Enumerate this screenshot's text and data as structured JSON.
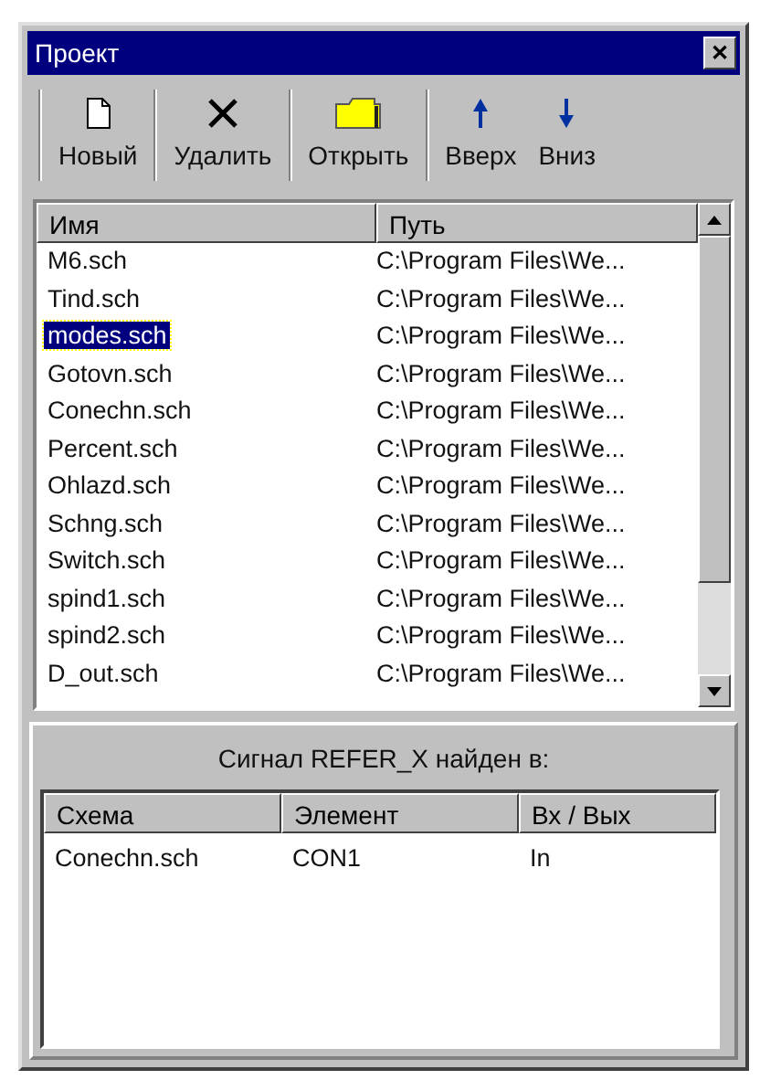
{
  "window": {
    "title": "Проект",
    "close": "✕"
  },
  "toolbar": [
    {
      "kind": "new",
      "label": "Новый"
    },
    {
      "kind": "delete",
      "label": "Удалить"
    },
    {
      "kind": "open",
      "label": "Открыть"
    },
    {
      "kind": "up",
      "label": "Вверх"
    },
    {
      "kind": "down",
      "label": "Вниз"
    }
  ],
  "files": {
    "columns": [
      "Имя",
      "Путь"
    ],
    "rows": [
      {
        "name": "M6.sch",
        "path": "C:\\Program Files\\We...",
        "selected": false
      },
      {
        "name": "Tind.sch",
        "path": "C:\\Program Files\\We...",
        "selected": false
      },
      {
        "name": "modes.sch",
        "path": "C:\\Program Files\\We...",
        "selected": true
      },
      {
        "name": "Gotovn.sch",
        "path": "C:\\Program Files\\We...",
        "selected": false
      },
      {
        "name": "Conechn.sch",
        "path": "C:\\Program Files\\We...",
        "selected": false
      },
      {
        "name": "Percent.sch",
        "path": "C:\\Program Files\\We...",
        "selected": false
      },
      {
        "name": "Ohlazd.sch",
        "path": "C:\\Program Files\\We...",
        "selected": false
      },
      {
        "name": "Schng.sch",
        "path": "C:\\Program Files\\We...",
        "selected": false
      },
      {
        "name": "Switch.sch",
        "path": "C:\\Program Files\\We...",
        "selected": false
      },
      {
        "name": "spind1.sch",
        "path": "C:\\Program Files\\We...",
        "selected": false
      },
      {
        "name": "spind2.sch",
        "path": "C:\\Program Files\\We...",
        "selected": false
      },
      {
        "name": "D_out.sch",
        "path": "C:\\Program Files\\We...",
        "selected": false
      }
    ]
  },
  "signal": {
    "title": "Сигнал  REFER_X  найден в:",
    "columns": [
      "Схема",
      "Элемент",
      "Вх / Вых"
    ],
    "rows": [
      [
        "Conechn.sch",
        "CON1",
        "In"
      ]
    ]
  }
}
